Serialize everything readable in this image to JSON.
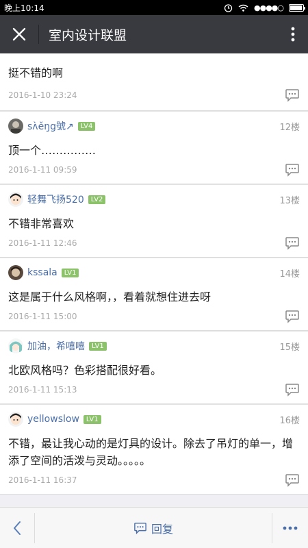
{
  "status": {
    "time": "晚上10:14"
  },
  "header": {
    "title": "室内设计联盟"
  },
  "posts": [
    {
      "content": "挺不错的啊",
      "date": "2016-1-10 23:24"
    },
    {
      "username": "sʌ̀ěŋg號↗",
      "level": "LV4",
      "floor": "12楼",
      "content": "顶一个……………",
      "date": "2016-1-11 09:59"
    },
    {
      "username": "轻舞飞扬520",
      "level": "LV2",
      "floor": "13楼",
      "content": "不错非常喜欢",
      "date": "2016-1-11 12:46"
    },
    {
      "username": "kssala",
      "level": "LV1",
      "floor": "14楼",
      "content": "这是属于什么风格啊，，看着就想住进去呀",
      "date": "2016-1-11 15:00"
    },
    {
      "username": "加油，希嘻嘻",
      "level": "LV1",
      "floor": "15楼",
      "content": "北欧风格吗？色彩搭配很好看。",
      "date": "2016-1-11 15:13"
    },
    {
      "username": "yellowslow",
      "level": "LV1",
      "floor": "16楼",
      "content": "不错，最让我心动的是灯具的设计。除去了吊灯的单一，增添了空间的活泼与灵动。。。。。",
      "date": "2016-1-11 16:37"
    }
  ],
  "footer": {
    "reply_label": "回复"
  },
  "colors": {
    "header_bg": "#393a3f",
    "link_blue": "#4a6ea8",
    "level_green": "#8cc36a"
  }
}
